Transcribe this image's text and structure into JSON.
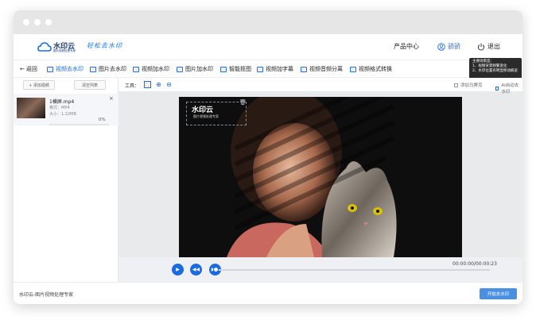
{
  "header": {
    "logo_text": "水印云",
    "logo_sub": "图片视频处理专家",
    "slogan": "轻松去水印",
    "product_center": "产品中心",
    "user": "骄骄",
    "logout": "退出"
  },
  "toolbar": {
    "back": "返回",
    "items": [
      "视频去水印",
      "图片去水印",
      "视频加水印",
      "图片加水印",
      "智能抠图",
      "视频加字幕",
      "视频音频分离",
      "视频格式转换"
    ]
  },
  "tooltip": {
    "title": "主要场景是：",
    "line1": "1、视频背景频繁变化",
    "line2": "2、水印位置有明显移动痕迹"
  },
  "sidebar": {
    "add_video": "+ 添加视频",
    "clear_list": "清空列表",
    "file": {
      "name": "1横屏.mp4",
      "format": "格式：MP4",
      "size": "大小：1.22MB",
      "progress_text": "0%",
      "progress": 0
    }
  },
  "workspace": {
    "tools_label": "工具：",
    "add_mosaic": "添加马赛克",
    "ai_remove": "AI自动去水印",
    "wm_logo": "水印云",
    "wm_sub": "图片视频处理专家",
    "time": "00:00:00/00:00:23",
    "progress": 0
  },
  "footer": {
    "text": "水印云-图片视频处理专家",
    "start_button": "开始去水印"
  },
  "colors": {
    "accent": "#1a6bdf",
    "button": "#4a90e2"
  }
}
